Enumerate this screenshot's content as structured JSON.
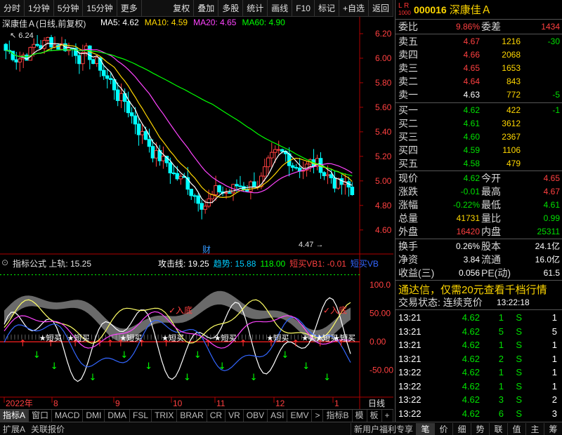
{
  "toolbar": {
    "items": [
      "分时",
      "1分钟",
      "5分钟",
      "15分钟",
      "更多",
      "复权",
      "叠加",
      "多股",
      "统计",
      "画线",
      "F10",
      "标记",
      "+自选",
      "返回"
    ]
  },
  "chart": {
    "stock_label": "深康佳Ａ(日线,前复权)",
    "ma_labels": [
      {
        "text": "MA5: 4.62",
        "color": "#ffffff"
      },
      {
        "text": "MA10: 4.59",
        "color": "#ffd700"
      },
      {
        "text": "MA20: 4.65",
        "color": "#ff44ff"
      },
      {
        "text": "MA60: 4.90",
        "color": "#00ff00"
      }
    ],
    "price_axis": [
      "6.20",
      "6.00",
      "5.80",
      "5.60",
      "5.40",
      "5.20",
      "5.00",
      "4.80",
      "4.60"
    ],
    "high_mark": "6.24",
    "low_mark": "4.47",
    "cai_label": "财",
    "indicator_header": "指标公式 上轨: 15.25",
    "indicator_values": [
      {
        "text": "攻击线: 19.25",
        "color": "#ffffff"
      },
      {
        "text": "趋势: 15.88",
        "color": "#00ccff"
      },
      {
        "text": "118.00",
        "color": "#00ff00"
      },
      {
        "text": "短买VB1: -0.01",
        "color": "#ff4040"
      },
      {
        "text": "短买VB",
        "color": "#3366ff"
      }
    ],
    "indicator_axis": [
      "100.0",
      "50.00",
      "0.00",
      "-50.00"
    ],
    "signal_labels": [
      "短买",
      "短买",
      "短买",
      "短买",
      "短买",
      "短买",
      "买入",
      "短买",
      "短买"
    ],
    "bottom_labels": [
      "入底",
      "入底"
    ],
    "date_axis": [
      "2022年",
      "8",
      "9",
      "10",
      "11",
      "12",
      "1"
    ],
    "period_label": "日线"
  },
  "tabs": [
    "指标A",
    "窗口",
    "MACD",
    "DMI",
    "DMA",
    "FSL",
    "TRIX",
    "BRAR",
    "CR",
    "VR",
    "OBV",
    "ASI",
    "EMV",
    ">",
    "指标B",
    "模",
    "板",
    "+",
    "-"
  ],
  "statusbar": {
    "left": [
      "扩展A",
      "关联报价"
    ],
    "promo": "新用户福利专享",
    "icons": [
      "笔",
      "价",
      "细",
      "势",
      "联",
      "值",
      "主",
      "筹"
    ]
  },
  "panel": {
    "lr_badge": "L R",
    "lr_sub": "1000",
    "code": "000016",
    "name": "深康佳Ａ",
    "weibi_label": "委比",
    "weibi_value": "9.86%",
    "weicha_label": "委差",
    "weicha_value": "1434",
    "asks": [
      {
        "label": "卖五",
        "price": "4.67",
        "vol": "1216",
        "chg": "-30"
      },
      {
        "label": "卖四",
        "price": "4.66",
        "vol": "2068",
        "chg": ""
      },
      {
        "label": "卖三",
        "price": "4.65",
        "vol": "1653",
        "chg": ""
      },
      {
        "label": "卖二",
        "price": "4.64",
        "vol": "843",
        "chg": ""
      },
      {
        "label": "卖一",
        "price": "4.63",
        "vol": "772",
        "chg": "-5"
      }
    ],
    "bids": [
      {
        "label": "买一",
        "price": "4.62",
        "vol": "422",
        "chg": "-1"
      },
      {
        "label": "买二",
        "price": "4.61",
        "vol": "3612",
        "chg": ""
      },
      {
        "label": "买三",
        "price": "4.60",
        "vol": "2367",
        "chg": ""
      },
      {
        "label": "买四",
        "price": "4.59",
        "vol": "1106",
        "chg": ""
      },
      {
        "label": "买五",
        "price": "4.58",
        "vol": "479",
        "chg": ""
      }
    ],
    "quote": [
      {
        "l1": "现价",
        "v1": "4.62",
        "c1": "grn",
        "l2": "今开",
        "v2": "4.65",
        "c2": "red"
      },
      {
        "l1": "涨跌",
        "v1": "-0.01",
        "c1": "grn",
        "l2": "最高",
        "v2": "4.67",
        "c2": "red"
      },
      {
        "l1": "涨幅",
        "v1": "-0.22%",
        "c1": "grn",
        "l2": "最低",
        "v2": "4.61",
        "c2": "grn"
      },
      {
        "l1": "总量",
        "v1": "41731",
        "c1": "yel",
        "l2": "量比",
        "v2": "0.99",
        "c2": "grn"
      },
      {
        "l1": "外盘",
        "v1": "16420",
        "c1": "red",
        "l2": "内盘",
        "v2": "25311",
        "c2": "grn"
      }
    ],
    "fundamentals": [
      {
        "l1": "换手",
        "v1": "0.26%",
        "l2": "股本",
        "v2": "24.1亿"
      },
      {
        "l1": "净资",
        "v1": "3.84",
        "l2": "流通",
        "v2": "16.0亿"
      },
      {
        "l1": "收益(三)",
        "v1": "0.056",
        "l2": "PE(动)",
        "v2": "61.5"
      }
    ],
    "ad": "通达信，仅需20元查看千档行情",
    "trade_status_label": "交易状态: 连续竞价",
    "trade_status_time": "13:22:18",
    "ticks": [
      {
        "time": "13:21",
        "price": "4.62",
        "vol": "1",
        "side": "S",
        "num": "1"
      },
      {
        "time": "13:21",
        "price": "4.62",
        "vol": "5",
        "side": "S",
        "num": "5"
      },
      {
        "time": "13:21",
        "price": "4.62",
        "vol": "1",
        "side": "S",
        "num": "1"
      },
      {
        "time": "13:21",
        "price": "4.62",
        "vol": "2",
        "side": "S",
        "num": "1"
      },
      {
        "time": "13:22",
        "price": "4.62",
        "vol": "1",
        "side": "S",
        "num": "1"
      },
      {
        "time": "13:22",
        "price": "4.62",
        "vol": "1",
        "side": "S",
        "num": "1"
      },
      {
        "time": "13:22",
        "price": "4.62",
        "vol": "3",
        "side": "S",
        "num": "2"
      },
      {
        "time": "13:22",
        "price": "4.62",
        "vol": "6",
        "side": "S",
        "num": "3"
      }
    ]
  }
}
